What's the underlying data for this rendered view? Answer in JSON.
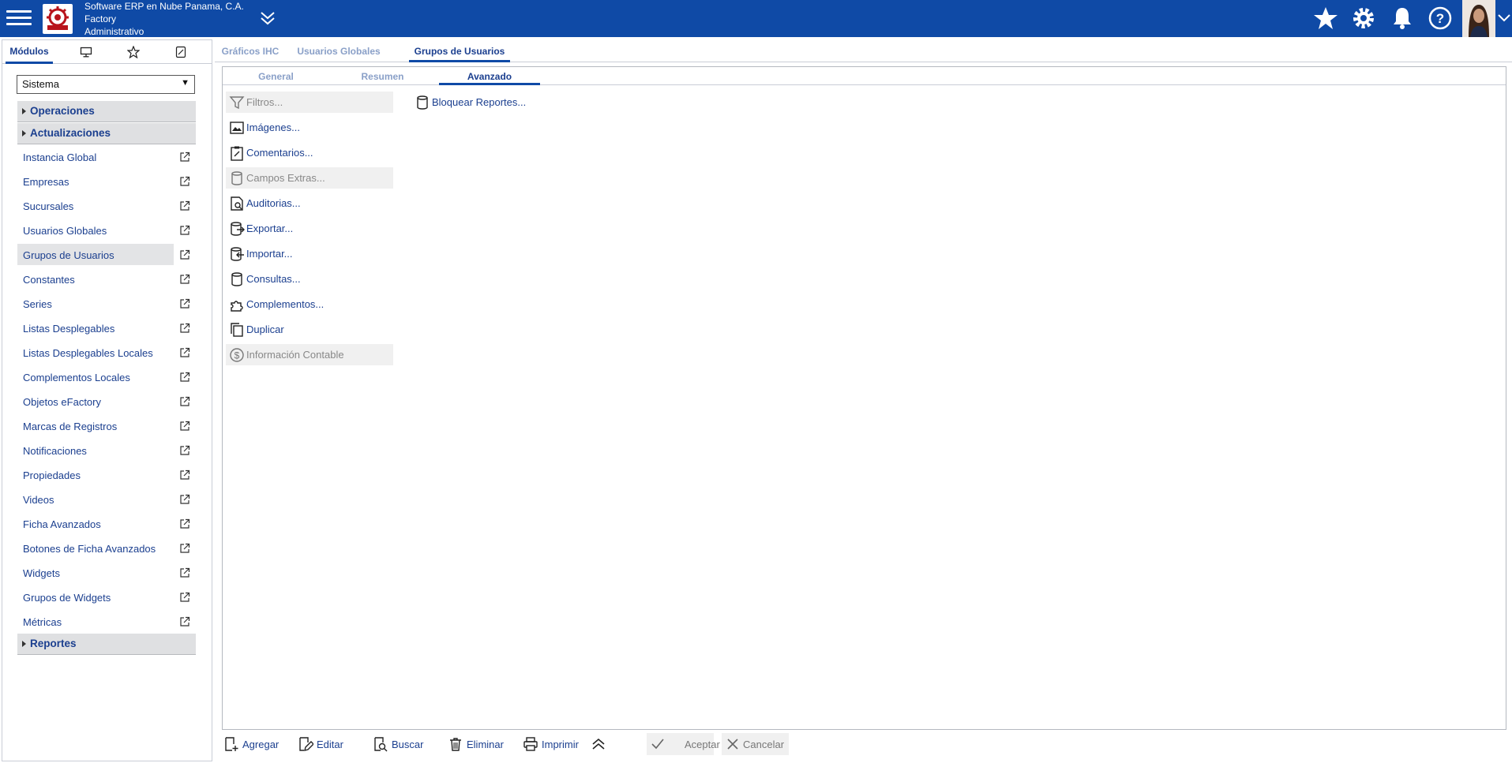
{
  "header": {
    "company_line1": "Software ERP en Nube Panama, C.A.",
    "company_line2": "Factory",
    "company_line3": "Administrativo",
    "brand_color": "#0f4aa6"
  },
  "left_panel": {
    "tabs": [
      "Módulos",
      "monitor-icon",
      "star-icon",
      "note-icon"
    ],
    "module_select_value": "Sistema",
    "sections": {
      "operaciones": "Operaciones",
      "actualizaciones": "Actualizaciones",
      "reportes": "Reportes"
    },
    "items": [
      "Instancia Global",
      "Empresas",
      "Sucursales",
      "Usuarios Globales",
      "Grupos de Usuarios",
      "Constantes",
      "Series",
      "Listas Desplegables",
      "Listas Desplegables Locales",
      "Complementos Locales",
      "Objetos eFactory",
      "Marcas de Registros",
      "Notificaciones",
      "Propiedades",
      "Videos",
      "Ficha Avanzados",
      "Botones de Ficha Avanzados",
      "Widgets",
      "Grupos de Widgets",
      "Métricas"
    ],
    "active_item": "Grupos de Usuarios"
  },
  "workspace_tabs": [
    "Gráficos IHC",
    "Usuarios Globales",
    "Grupos de Usuarios"
  ],
  "content_tabs": [
    "General",
    "Resumen",
    "Avanzado"
  ],
  "actions_left": [
    {
      "label": "Filtros...",
      "icon": "filter-icon",
      "disabled": true
    },
    {
      "label": "Imágenes...",
      "icon": "image-icon",
      "disabled": false
    },
    {
      "label": "Comentarios...",
      "icon": "clipboard-icon",
      "disabled": false
    },
    {
      "label": "Campos Extras...",
      "icon": "database-icon",
      "disabled": true
    },
    {
      "label": "Auditorias...",
      "icon": "audit-icon",
      "disabled": false
    },
    {
      "label": "Exportar...",
      "icon": "export-icon",
      "disabled": false
    },
    {
      "label": "Importar...",
      "icon": "import-icon",
      "disabled": false
    },
    {
      "label": "Consultas...",
      "icon": "database-icon",
      "disabled": false
    },
    {
      "label": "Complementos...",
      "icon": "puzzle-icon",
      "disabled": false
    },
    {
      "label": "Duplicar",
      "icon": "copy-icon",
      "disabled": false
    },
    {
      "label": "Información Contable",
      "icon": "dollar-icon",
      "disabled": true
    }
  ],
  "actions_right": [
    {
      "label": "Bloquear Reportes...",
      "icon": "database-icon",
      "disabled": false
    }
  ],
  "toolbar": {
    "agregar": "Agregar",
    "editar": "Editar",
    "buscar": "Buscar",
    "eliminar": "Eliminar",
    "imprimir": "Imprimir",
    "aceptar": "Aceptar",
    "cancelar": "Cancelar"
  }
}
